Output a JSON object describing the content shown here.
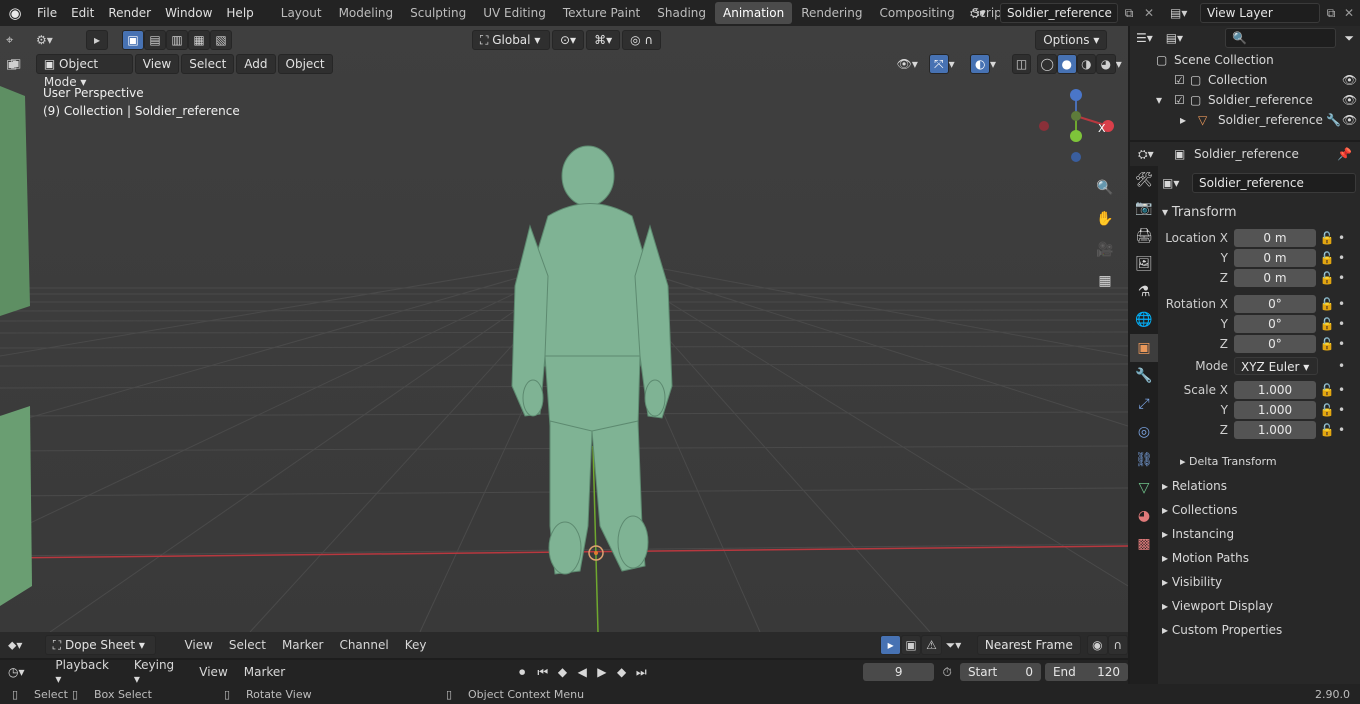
{
  "topbar": {
    "menus": [
      "File",
      "Edit",
      "Render",
      "Window",
      "Help"
    ],
    "workspaces": [
      "Layout",
      "Modeling",
      "Sculpting",
      "UV Editing",
      "Texture Paint",
      "Shading",
      "Animation",
      "Rendering",
      "Compositing",
      "Scripting"
    ],
    "active_workspace": "Animation",
    "scene_name": "Soldier_reference",
    "view_layer": "View Layer"
  },
  "viewport": {
    "mode": "Object Mode",
    "menus": [
      "View",
      "Select",
      "Add",
      "Object"
    ],
    "transform_orientation": "Global",
    "options_label": "Options",
    "overlay_line1": "User Perspective",
    "overlay_line2": "(9) Collection | Soldier_reference",
    "gizmo_x": "X",
    "colors": {
      "bg": "#3d3d3d",
      "figure": "#7fb394",
      "axis_x": "#b8383f",
      "axis_y": "#6fa82f"
    }
  },
  "outliner": {
    "scene_collection": "Scene Collection",
    "rows": [
      {
        "label": "Collection"
      },
      {
        "label": "Soldier_reference"
      },
      {
        "label": "Soldier_reference"
      }
    ]
  },
  "properties": {
    "object_name": "Soldier_reference",
    "object_field": "Soldier_reference",
    "transform_header": "Transform",
    "location": [
      {
        "label": "Location X",
        "value": "0 m"
      },
      {
        "label": "Y",
        "value": "0 m"
      },
      {
        "label": "Z",
        "value": "0 m"
      }
    ],
    "rotation": [
      {
        "label": "Rotation X",
        "value": "0°"
      },
      {
        "label": "Y",
        "value": "0°"
      },
      {
        "label": "Z",
        "value": "0°"
      }
    ],
    "mode_label": "Mode",
    "mode_value": "XYZ Euler",
    "scale": [
      {
        "label": "Scale X",
        "value": "1.000"
      },
      {
        "label": "Y",
        "value": "1.000"
      },
      {
        "label": "Z",
        "value": "1.000"
      }
    ],
    "delta_transform": "Delta Transform",
    "panels": [
      "Relations",
      "Collections",
      "Instancing",
      "Motion Paths",
      "Visibility",
      "Viewport Display",
      "Custom Properties"
    ]
  },
  "dopesheet": {
    "editor": "Dope Sheet",
    "menus": [
      "View",
      "Select",
      "Marker",
      "Channel",
      "Key"
    ],
    "snap": "Nearest Frame"
  },
  "timeline": {
    "playback": "Playback",
    "keying": "Keying",
    "menus": [
      "View",
      "Marker"
    ],
    "current_frame": "9",
    "start_label": "Start",
    "start": "0",
    "end_label": "End",
    "end": "120"
  },
  "status": {
    "select": "Select",
    "box_select": "Box Select",
    "rotate_view": "Rotate View",
    "context_menu": "Object Context Menu",
    "version": "2.90.0"
  }
}
